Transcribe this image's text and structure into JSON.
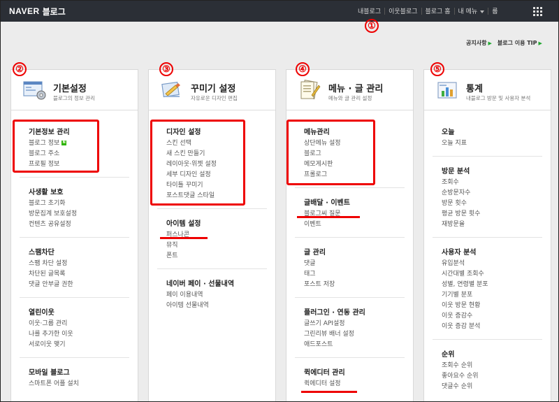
{
  "brand": {
    "naver": "NAVER",
    "blog": "블로그"
  },
  "topnav": {
    "items": [
      "내블로그",
      "이웃블로그",
      "블로그 홈",
      "내 메뉴",
      "룹"
    ]
  },
  "sublinks": [
    "공지사항",
    "블로그 이용 TIP"
  ],
  "annotations": [
    "①",
    "②",
    "③",
    "④",
    "⑤"
  ],
  "columns": [
    {
      "title": "기본설정",
      "desc": "블로그의 정보 관리",
      "groups": [
        {
          "title": "기본정보 관리",
          "items": [
            "블로그 정보",
            "블로그 주소",
            "프로필 정보"
          ]
        },
        {
          "title": "사생활 보호",
          "items": [
            "블로그 초기화",
            "방문집계 보호설정",
            "컨텐츠 공유설정"
          ]
        },
        {
          "title": "스팸차단",
          "items": [
            "스팸 차단 설정",
            "차단된 글목록",
            "댓글 안부글 권한"
          ]
        },
        {
          "title": "열린이웃",
          "items": [
            "이웃·그룹 관리",
            "나를 추가한 이웃",
            "서로이웃 맺기"
          ]
        },
        {
          "title": "모바일 블로그",
          "items": [
            "스마트폰 어플 설치"
          ]
        }
      ],
      "badge": "N"
    },
    {
      "title": "꾸미기 설정",
      "desc": "자유로운 디자인 편집",
      "groups": [
        {
          "title": "디자인 설정",
          "items": [
            "스킨 선택",
            "새 스킨 만들기",
            "레이아웃·위젯 설정",
            "세부 디자인 설정",
            "타이틀 꾸미기",
            "포스트댓글 스타일"
          ]
        },
        {
          "title": "아이템 설정",
          "items": [
            "퍼스나콘",
            "뮤직",
            "폰트"
          ]
        },
        {
          "title": "네이버 페이 · 선물내역",
          "items": [
            "페이 이용내역",
            "아이템 선물내역"
          ]
        }
      ]
    },
    {
      "title": "메뉴 · 글 관리",
      "desc": "메뉴와 글 관리 설정",
      "groups": [
        {
          "title": "메뉴관리",
          "items": [
            "상단메뉴 설정",
            "블로그",
            "메모게시판",
            "프롤로그"
          ]
        },
        {
          "title": "글배달 · 이벤트",
          "items": [
            "블로그씨 질문",
            "이벤트"
          ]
        },
        {
          "title": "글 관리",
          "items": [
            "댓글",
            "태그",
            "포스트 저장"
          ]
        },
        {
          "title": "플러그인 · 연동 관리",
          "items": [
            "글쓰기 API설정",
            "그린리뷰 배너 설정",
            "애드포스트"
          ]
        },
        {
          "title": "퀵에디터 관리",
          "items": [
            "퀵에디터 설정"
          ]
        }
      ]
    },
    {
      "title": "통계",
      "desc": "내블로그 방문 및 사용자 분석",
      "groups": [
        {
          "title": "오늘",
          "items": [
            "오늘 지표"
          ]
        },
        {
          "title": "방문 분석",
          "items": [
            "조회수",
            "순방문자수",
            "방문 횟수",
            "평균 방문 횟수",
            "재방문율"
          ]
        },
        {
          "title": "사용자 분석",
          "items": [
            "유입분석",
            "시간대별 조회수",
            "성별, 연령별 분포",
            "기기별 분포",
            "이웃 방문 현황",
            "이웃 증감수",
            "이웃 증감 분석"
          ]
        },
        {
          "title": "순위",
          "items": [
            "조회수 순위",
            "좋아요수 순위",
            "댓글수 순위"
          ]
        }
      ]
    }
  ]
}
